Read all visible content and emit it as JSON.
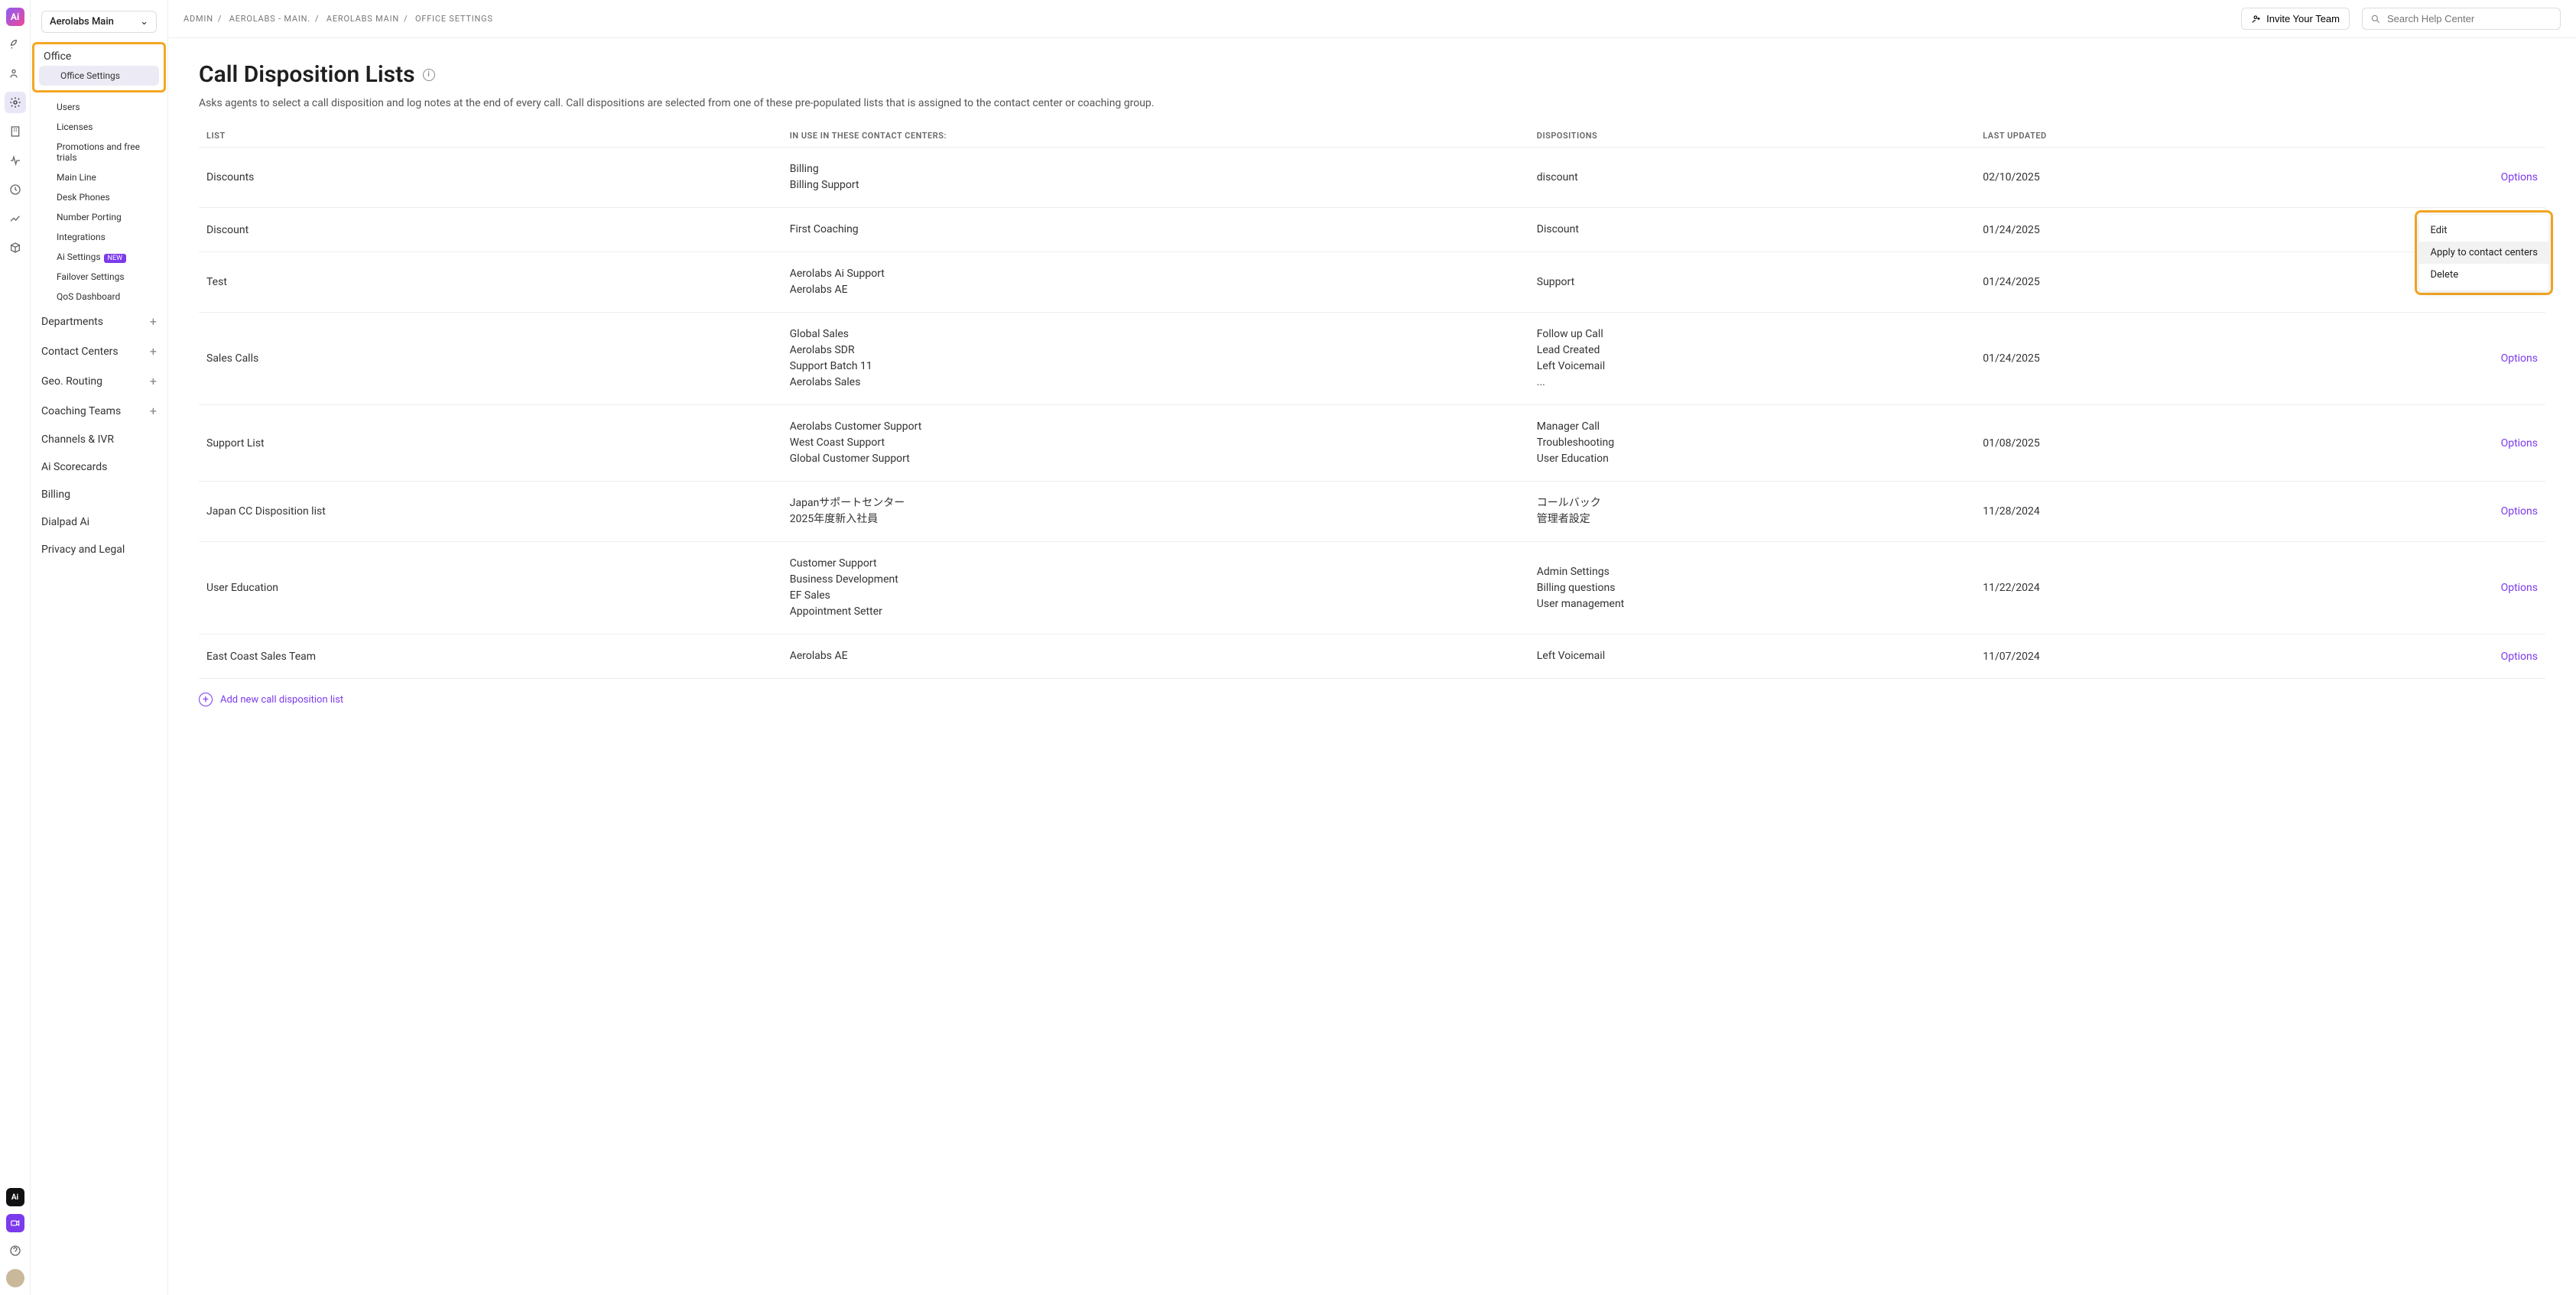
{
  "rail": {
    "logo_letter": "Ai"
  },
  "workspace": {
    "label": "Aerolabs Main"
  },
  "breadcrumbs": [
    "ADMIN",
    "AEROLABS - MAIN.",
    "AEROLABS MAIN",
    "OFFICE SETTINGS"
  ],
  "topbar": {
    "invite_label": "Invite Your Team",
    "search_placeholder": "Search Help Center"
  },
  "sidebar": {
    "office_label": "Office",
    "office_items": [
      "Office Settings",
      "Users",
      "Licenses",
      "Promotions and free trials",
      "Main Line",
      "Desk Phones",
      "Number Porting",
      "Integrations",
      "Ai Settings",
      "Failover Settings",
      "QoS Dashboard"
    ],
    "new_badge": "New",
    "groups": [
      "Departments",
      "Contact Centers",
      "Geo. Routing",
      "Coaching Teams",
      "Channels & IVR",
      "Ai Scorecards",
      "Billing",
      "Dialpad Ai",
      "Privacy and Legal"
    ]
  },
  "page": {
    "title": "Call Disposition Lists",
    "description": "Asks agents to select a call disposition and log notes at the end of every call. Call dispositions are selected from one of these pre-populated lists that is assigned to the contact center or coaching group.",
    "columns": [
      "LIST",
      "IN USE IN THESE CONTACT CENTERS:",
      "DISPOSITIONS",
      "LAST UPDATED",
      ""
    ],
    "options_label": "Options",
    "add_label": "Add new call disposition list"
  },
  "rows": [
    {
      "list": "Discounts",
      "centers": [
        "Billing",
        "Billing Support"
      ],
      "dispositions": [
        "discount"
      ],
      "updated": "02/10/2025"
    },
    {
      "list": "Discount",
      "centers": [
        "First Coaching"
      ],
      "dispositions": [
        "Discount"
      ],
      "updated": "01/24/2025"
    },
    {
      "list": "Test",
      "centers": [
        "Aerolabs Ai Support",
        "Aerolabs AE"
      ],
      "dispositions": [
        "Support"
      ],
      "updated": "01/24/2025"
    },
    {
      "list": "Sales Calls",
      "centers": [
        "Global Sales",
        "Aerolabs SDR",
        "Support Batch 11",
        "Aerolabs Sales"
      ],
      "dispositions": [
        "Follow up Call",
        "Lead Created",
        "Left Voicemail",
        "..."
      ],
      "updated": "01/24/2025"
    },
    {
      "list": "Support List",
      "centers": [
        "Aerolabs Customer Support",
        "West Coast Support",
        "Global Customer Support"
      ],
      "dispositions": [
        "Manager Call",
        "Troubleshooting",
        "User Education"
      ],
      "updated": "01/08/2025"
    },
    {
      "list": "Japan CC Disposition list",
      "centers": [
        "Japanサポートセンター",
        "2025年度新入社員"
      ],
      "dispositions": [
        "コールバック",
        "管理者設定"
      ],
      "updated": "11/28/2024"
    },
    {
      "list": "User Education",
      "centers": [
        "Customer Support",
        "Business Development",
        "EF Sales",
        "Appointment Setter"
      ],
      "dispositions": [
        "Admin Settings",
        "Billing questions",
        "User management"
      ],
      "updated": "11/22/2024"
    },
    {
      "list": "East Coast Sales Team",
      "centers": [
        "Aerolabs AE"
      ],
      "dispositions": [
        "Left Voicemail"
      ],
      "updated": "11/07/2024"
    }
  ],
  "dropdown": {
    "items": [
      "Edit",
      "Apply to contact centers",
      "Delete"
    ]
  }
}
